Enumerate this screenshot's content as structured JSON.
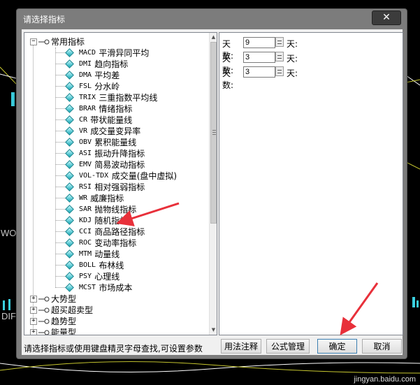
{
  "dialog": {
    "title": "请选择指标",
    "close_glyph": "✕"
  },
  "tree": {
    "groups": [
      {
        "label": "常用指标",
        "expanded": true,
        "children": [
          {
            "code": "MACD",
            "name": "平滑异同平均"
          },
          {
            "code": "DMI",
            "name": "趋向指标"
          },
          {
            "code": "DMA",
            "name": "平均差"
          },
          {
            "code": "FSL",
            "name": "分水岭"
          },
          {
            "code": "TRIX",
            "name": "三重指数平均线"
          },
          {
            "code": "BRAR",
            "name": "情绪指标"
          },
          {
            "code": "CR",
            "name": "带状能量线"
          },
          {
            "code": "VR",
            "name": "成交量变异率"
          },
          {
            "code": "OBV",
            "name": "累积能量线"
          },
          {
            "code": "ASI",
            "name": "振动升降指标"
          },
          {
            "code": "EMV",
            "name": "简易波动指标"
          },
          {
            "code": "VOL-TDX",
            "name": "成交量(盘中虚拟)"
          },
          {
            "code": "RSI",
            "name": "相对强弱指标"
          },
          {
            "code": "WR",
            "name": "威廉指标"
          },
          {
            "code": "SAR",
            "name": "抛物线指标"
          },
          {
            "code": "KDJ",
            "name": "随机指标"
          },
          {
            "code": "CCI",
            "name": "商品路径指标"
          },
          {
            "code": "ROC",
            "name": "变动率指标"
          },
          {
            "code": "MTM",
            "name": "动量线"
          },
          {
            "code": "BOLL",
            "name": "布林线"
          },
          {
            "code": "PSY",
            "name": "心理线"
          },
          {
            "code": "MCST",
            "name": "市场成本"
          }
        ]
      },
      {
        "label": "大势型",
        "expanded": false
      },
      {
        "label": "超买超卖型",
        "expanded": false
      },
      {
        "label": "趋势型",
        "expanded": false
      },
      {
        "label": "能量型",
        "expanded": false
      }
    ],
    "expand_minus": "−",
    "expand_plus": "+"
  },
  "params": [
    {
      "label": "天数:",
      "value": "9",
      "suffix": "天:"
    },
    {
      "label": "天数:",
      "value": "3",
      "suffix": "天:"
    },
    {
      "label": "天数:",
      "value": "3",
      "suffix": "天:"
    }
  ],
  "status_text": "请选择指标或使用键盘精灵字母查找,可设置参数",
  "buttons": {
    "usage": "用法注释",
    "formula": "公式管理",
    "ok": "确定",
    "cancel": "取消"
  },
  "background": {
    "label_wo": "WO",
    "label_dif": "DIF",
    "watermark": "jingyan.baidu.com"
  },
  "colors": {
    "arrow_red": "#e8303a",
    "tree_icon_cyan": "#13a8b6"
  }
}
